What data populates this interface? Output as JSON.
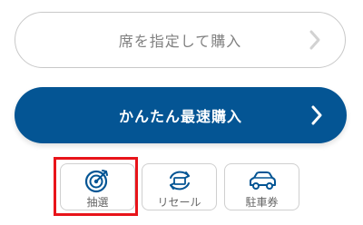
{
  "buttons": {
    "seat_select_label": "席を指定して購入",
    "quick_purchase_label": "かんたん最速購入"
  },
  "tiles": {
    "lottery": {
      "label": "抽選",
      "icon": "target-icon"
    },
    "resale": {
      "label": "リセール",
      "icon": "ticket-cycle-icon"
    },
    "parking": {
      "label": "駐車券",
      "icon": "car-icon"
    }
  },
  "colors": {
    "primary": "#045594",
    "highlight": "#e8141a",
    "border": "#c8c8c8",
    "text_gray": "#808080"
  }
}
